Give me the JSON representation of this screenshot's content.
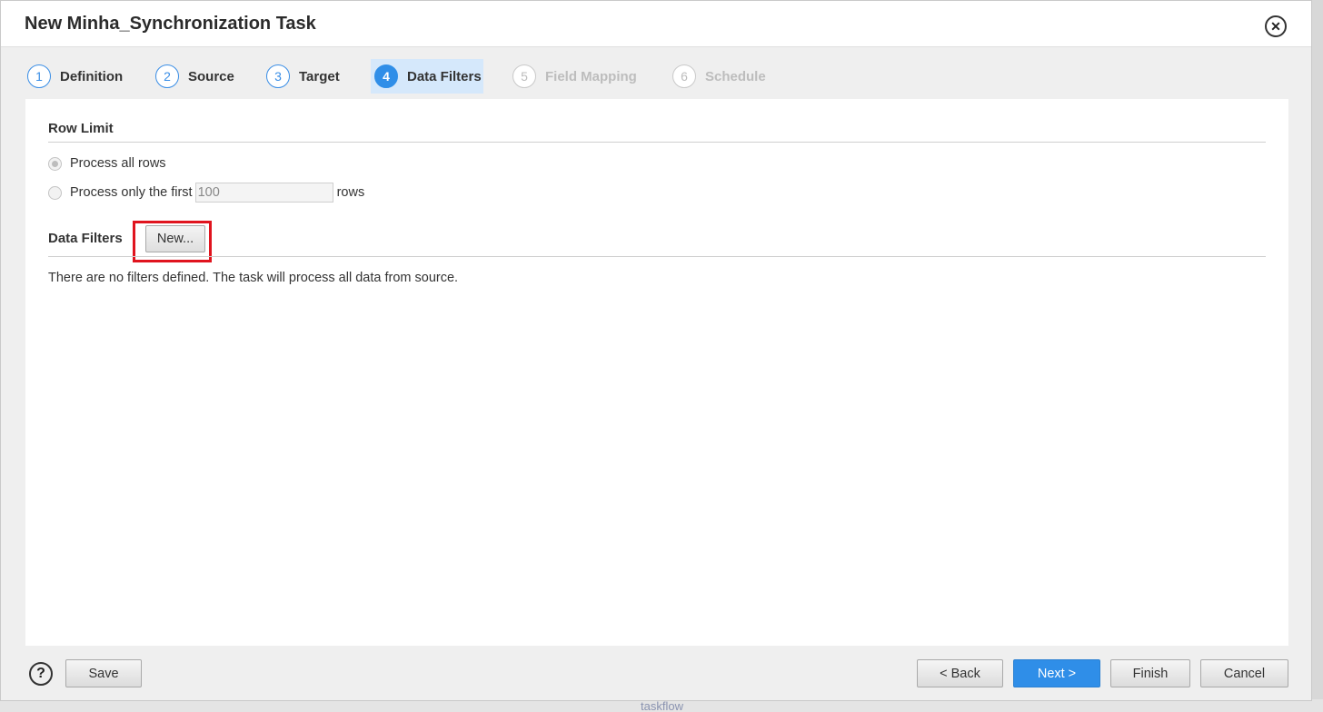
{
  "dialog": {
    "title": "New Minha_Synchronization Task",
    "close_icon": "close-icon"
  },
  "steps": [
    {
      "num": "1",
      "label": "Definition",
      "state": "completed"
    },
    {
      "num": "2",
      "label": "Source",
      "state": "completed"
    },
    {
      "num": "3",
      "label": "Target",
      "state": "completed"
    },
    {
      "num": "4",
      "label": "Data Filters",
      "state": "active"
    },
    {
      "num": "5",
      "label": "Field Mapping",
      "state": "disabled"
    },
    {
      "num": "6",
      "label": "Schedule",
      "state": "disabled"
    }
  ],
  "row_limit": {
    "title": "Row Limit",
    "option_all": "Process all rows",
    "option_first_prefix": "Process only the first",
    "option_first_value": "100",
    "option_first_suffix": "rows",
    "selected": "all"
  },
  "data_filters": {
    "title": "Data Filters",
    "new_button": "New...",
    "empty_message": "There are no filters defined. The task will process all data from source."
  },
  "footer": {
    "help_icon": "help-icon",
    "help_glyph": "?",
    "save": "Save",
    "back": "< Back",
    "next": "Next >",
    "finish": "Finish",
    "cancel": "Cancel"
  },
  "background": {
    "faint_text": "taskflow"
  },
  "colors": {
    "accent": "#2f8ee8",
    "active_step_bg": "#d5e8fb",
    "highlight_box": "#e0141e"
  }
}
